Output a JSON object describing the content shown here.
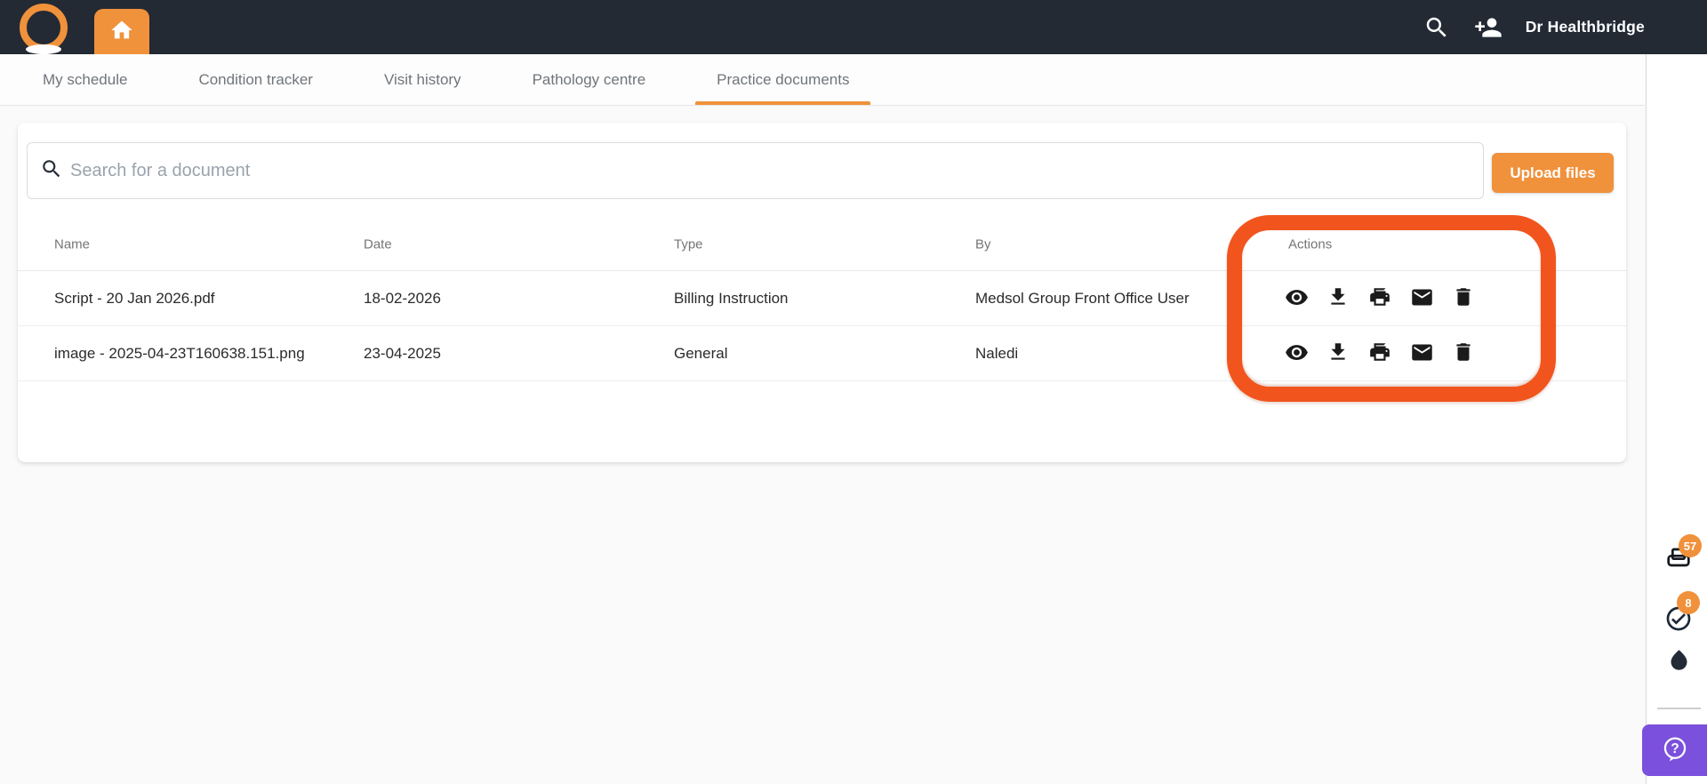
{
  "topbar": {
    "logo_icon": "healthbridge-logo",
    "home_icon": "home-icon",
    "search_icon": "search-icon",
    "add_person_icon": "person-add-icon",
    "user_name": "Dr Healthbridge",
    "bg_color": "#232a34",
    "accent_color": "#f0913b"
  },
  "tabs": {
    "items": [
      {
        "label": "My schedule"
      },
      {
        "label": "Condition tracker"
      },
      {
        "label": "Visit history"
      },
      {
        "label": "Pathology centre"
      },
      {
        "label": "Practice documents"
      }
    ],
    "active_label": "Practice documents",
    "active_underline_color": "#f0913b"
  },
  "search": {
    "placeholder": "Search for a document",
    "value": "",
    "icon": "search-icon"
  },
  "upload_button": {
    "label": "Upload files",
    "color": "#f0913b"
  },
  "table": {
    "columns": [
      "Name",
      "Date",
      "Type",
      "By",
      "Actions"
    ],
    "rows": [
      {
        "name": "Script - 20 Jan 2026.pdf",
        "date": "18-02-2026",
        "type": "Billing Instruction",
        "by": "Medsol Group Front Office User"
      },
      {
        "name": "image - 2025-04-23T160638.151.png",
        "date": "23-04-2025",
        "type": "General",
        "by": "Naledi"
      }
    ],
    "row_actions": [
      "view",
      "download",
      "print",
      "email",
      "delete"
    ]
  },
  "annotation": {
    "shape": "rounded-rectangle",
    "color": "#f1551d",
    "target": "Actions column"
  },
  "rail": {
    "print_queue": {
      "icon": "print-queue-icon",
      "badge": "57"
    },
    "tasks": {
      "icon": "check-circle-icon",
      "badge": "8"
    },
    "ink": {
      "icon": "water-drop-icon"
    },
    "help": {
      "icon": "help-icon",
      "color": "#7b50dc"
    },
    "badge_color": "#f0913b"
  }
}
